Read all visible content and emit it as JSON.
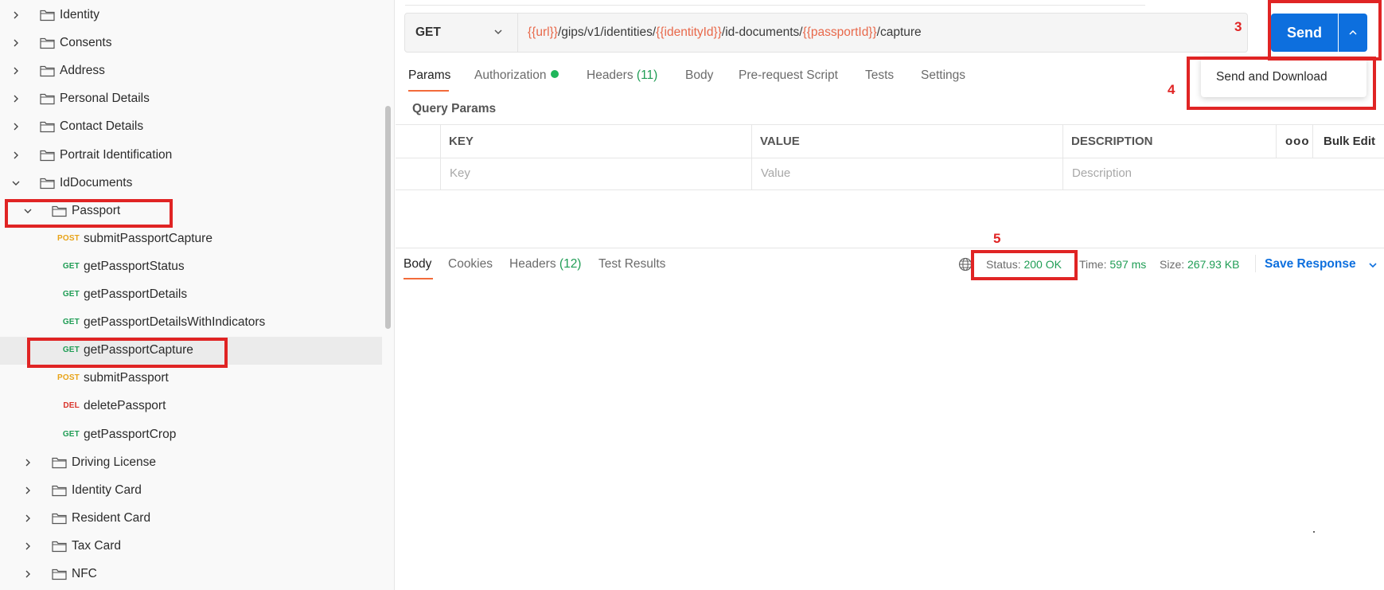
{
  "sidebar": {
    "items": [
      {
        "type": "folder",
        "label": "Identity",
        "expanded": false
      },
      {
        "type": "folder",
        "label": "Consents",
        "expanded": false
      },
      {
        "type": "folder",
        "label": "Address",
        "expanded": false
      },
      {
        "type": "folder",
        "label": "Personal Details",
        "expanded": false
      },
      {
        "type": "folder",
        "label": "Contact Details",
        "expanded": false
      },
      {
        "type": "folder",
        "label": "Portrait Identification",
        "expanded": false
      },
      {
        "type": "folder",
        "label": "IdDocuments",
        "expanded": true
      },
      {
        "type": "folder",
        "label": "Passport",
        "expanded": true
      },
      {
        "type": "request",
        "method": "POST",
        "label": "submitPassportCapture"
      },
      {
        "type": "request",
        "method": "GET",
        "label": "getPassportStatus"
      },
      {
        "type": "request",
        "method": "GET",
        "label": "getPassportDetails"
      },
      {
        "type": "request",
        "method": "GET",
        "label": "getPassportDetailsWithIndicators"
      },
      {
        "type": "request",
        "method": "GET",
        "label": "getPassportCapture",
        "selected": true
      },
      {
        "type": "request",
        "method": "POST",
        "label": "submitPassport"
      },
      {
        "type": "request",
        "method": "DEL",
        "label": "deletePassport"
      },
      {
        "type": "request",
        "method": "GET",
        "label": "getPassportCrop"
      },
      {
        "type": "folder",
        "label": "Driving License",
        "expanded": false
      },
      {
        "type": "folder",
        "label": "Identity Card",
        "expanded": false
      },
      {
        "type": "folder",
        "label": "Resident Card",
        "expanded": false
      },
      {
        "type": "folder",
        "label": "Tax Card",
        "expanded": false
      },
      {
        "type": "folder",
        "label": "NFC",
        "expanded": false
      }
    ]
  },
  "request": {
    "method": "GET",
    "url_parts": [
      {
        "text": "{{url}}",
        "var": true
      },
      {
        "text": "/gips/v1/identities/",
        "var": false
      },
      {
        "text": "{{identityId}}",
        "var": true
      },
      {
        "text": "/id-documents/",
        "var": false
      },
      {
        "text": "{{passportId}}",
        "var": true
      },
      {
        "text": "/capture",
        "var": false
      }
    ],
    "send_label": "Send",
    "send_menu_item": "Send and Download"
  },
  "request_tabs": {
    "params": "Params",
    "authorization": "Authorization",
    "headers": "Headers",
    "headers_count": "(11)",
    "body": "Body",
    "prerequest": "Pre-request Script",
    "tests": "Tests",
    "settings": "Settings"
  },
  "query_params": {
    "title": "Query Params",
    "columns": [
      "KEY",
      "VALUE",
      "DESCRIPTION"
    ],
    "placeholders": [
      "Key",
      "Value",
      "Description"
    ],
    "more": "ooo",
    "bulk_edit": "Bulk Edit"
  },
  "response": {
    "tabs": {
      "body": "Body",
      "cookies": "Cookies",
      "headers": "Headers",
      "headers_count": "(12)",
      "test_results": "Test Results"
    },
    "status_label": "Status:",
    "status_value": "200 OK",
    "time_label": "Time:",
    "time_value": "597 ms",
    "size_label": "Size:",
    "size_value": "267.93 KB",
    "save_response": "Save Response"
  },
  "annotations": [
    "3",
    "4",
    "5"
  ],
  "colors": {
    "accent": "#f26b3a",
    "primary": "#0d6fde",
    "ok": "#1f9d55",
    "annotation": "#e02424"
  }
}
